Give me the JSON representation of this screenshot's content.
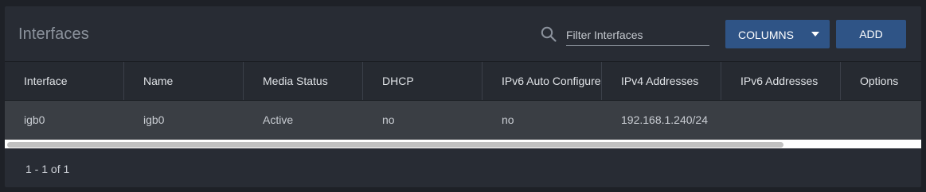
{
  "panel": {
    "title": "Interfaces"
  },
  "search": {
    "placeholder": "Filter Interfaces",
    "value": ""
  },
  "toolbar": {
    "columns_label": "COLUMNS",
    "add_label": "ADD"
  },
  "table": {
    "columns": [
      "Interface",
      "Name",
      "Media Status",
      "DHCP",
      "IPv6 Auto Configure",
      "IPv4 Addresses",
      "IPv6 Addresses",
      "Options"
    ],
    "rows": [
      [
        "igb0",
        "igb0",
        "Active",
        "no",
        "no",
        "192.168.1.240/24",
        "",
        ""
      ]
    ]
  },
  "pagination": {
    "summary": "1 - 1 of 1"
  },
  "colors": {
    "background": "#1e2127",
    "card": "#282c34",
    "row": "#3a3e44",
    "button": "#2f5486"
  }
}
